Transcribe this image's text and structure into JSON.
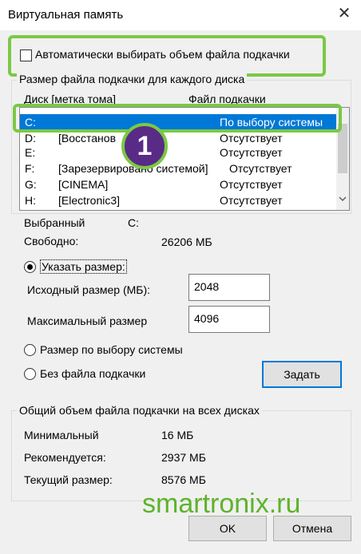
{
  "window": {
    "title": "Виртуальная память",
    "close_glyph": "✕"
  },
  "auto_checkbox": {
    "label": "Автоматически выбирать объем файла подкачки",
    "checked": false
  },
  "drives_group": {
    "title": "Размер файла подкачки для каждого диска",
    "col_drive": "Диск [метка тома]",
    "col_pagefile": "Файл подкачки",
    "rows": [
      {
        "drive": "C:",
        "label": "",
        "pagefile": "По выбору системы",
        "selected": true
      },
      {
        "drive": "D:",
        "label": "[Восстанов",
        "pagefile": "Отсутствует",
        "selected": false
      },
      {
        "drive": "E:",
        "label": "",
        "pagefile": "Отсутствует",
        "selected": false
      },
      {
        "drive": "F:",
        "label": "[Зарезервировано системой]",
        "pagefile": "Отсутствует",
        "selected": false
      },
      {
        "drive": "G:",
        "label": "[CINEMA]",
        "pagefile": "Отсутствует",
        "selected": false
      },
      {
        "drive": "H:",
        "label": "[Electronic3]",
        "pagefile": "Отсутствует",
        "selected": false
      }
    ],
    "badge_number": "1"
  },
  "selected_info": {
    "selected_label": "Выбранный",
    "selected_value": "C:",
    "free_label": "Свободно:",
    "free_value": "26206 МБ"
  },
  "custom_size": {
    "radio_label": "Указать размер:",
    "initial_label": "Исходный размер (МБ):",
    "initial_value": "2048",
    "max_label": "Максимальный размер",
    "max_value": "4096"
  },
  "system_size_radio": "Размер по выбору системы",
  "no_pagefile_radio": "Без файла подкачки",
  "set_button": "Задать",
  "totals_group": {
    "title": "Общий объем файла подкачки на всех дисках",
    "min_label": "Минимальный",
    "min_value": "16 МБ",
    "recommended_label": "Рекомендуется:",
    "recommended_value": "2937 МБ",
    "current_label": "Текущий размер:",
    "current_value": "8576 МБ"
  },
  "ok_button": "OK",
  "cancel_button": "Отмена",
  "watermark": "smartronix.ru",
  "colors": {
    "highlight": "#7ac943",
    "selection": "#0078d7",
    "badge": "#5a2a87"
  }
}
